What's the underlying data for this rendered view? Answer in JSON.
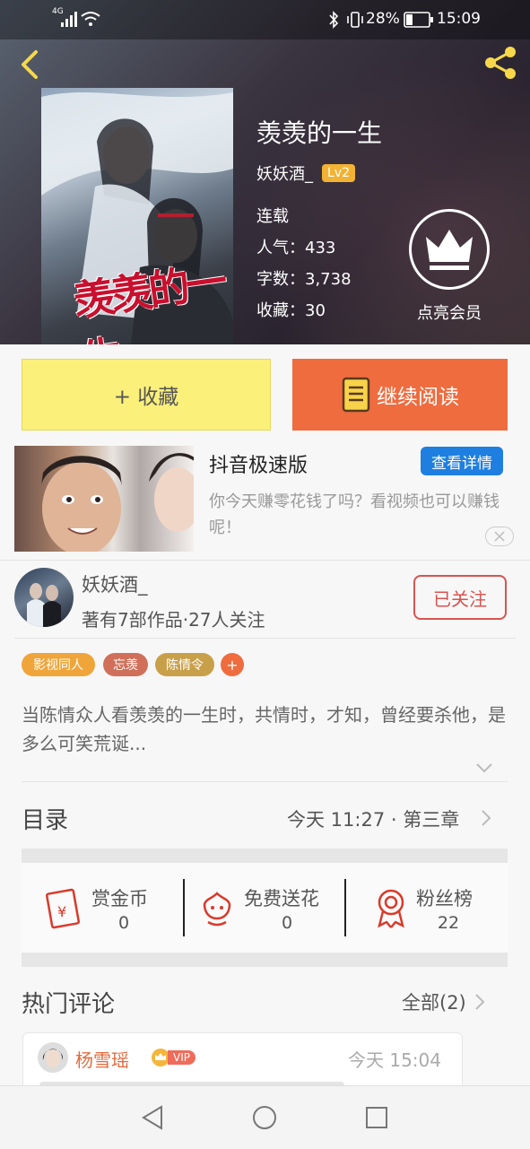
{
  "status_bar": {
    "network": "4G",
    "battery": "28%",
    "time": "15:09"
  },
  "book": {
    "title": "羡羡的一生",
    "author": "妖妖酒_",
    "level": "Lv2",
    "status": "连载",
    "popularity": "人气：433",
    "word_count": "字数：3,738",
    "favorites": "收藏：30",
    "cover_title": "羡羡的一生"
  },
  "member": {
    "label": "点亮会员"
  },
  "actions": {
    "favorite_label": "+ 收藏",
    "read_label": "继续阅读"
  },
  "ad": {
    "title": "抖音极速版",
    "button": "查看详情",
    "desc": "你今天赚零花钱了吗？看视频也可以赚钱呢！"
  },
  "author_card": {
    "name": "妖妖酒_",
    "meta": "著有7部作品·27人关注",
    "follow_label": "已关注"
  },
  "tags": [
    {
      "label": "影视同人",
      "color": "#f0a53a"
    },
    {
      "label": "忘羡",
      "color": "#d0705a"
    },
    {
      "label": "陈情令",
      "color": "#c9a04a"
    },
    {
      "label": "+",
      "color": "#ef6c3f"
    }
  ],
  "synopsis": "当陈情众人看羡羡的一生时，共情时，才知，曾经要杀他，是多么可笑荒诞...",
  "toc": {
    "label": "目录",
    "latest": "今天 11:27 · 第三章"
  },
  "stats": [
    {
      "label": "赏金币",
      "value": "0",
      "icon": "red-envelope-icon"
    },
    {
      "label": "免费送花",
      "value": "0",
      "icon": "flower-icon"
    },
    {
      "label": "粉丝榜",
      "value": "22",
      "icon": "medal-icon"
    }
  ],
  "comments": {
    "heading": "热门评论",
    "all_label": "全部(2)",
    "first": {
      "user": "杨雪瑶",
      "badge": "VIP",
      "time": "今天 15:04"
    }
  },
  "colors": {
    "accent": "#ef6c3f",
    "fav_yellow": "#fbf07a",
    "red": "#d9534f",
    "blue": "#1e7fe0"
  }
}
